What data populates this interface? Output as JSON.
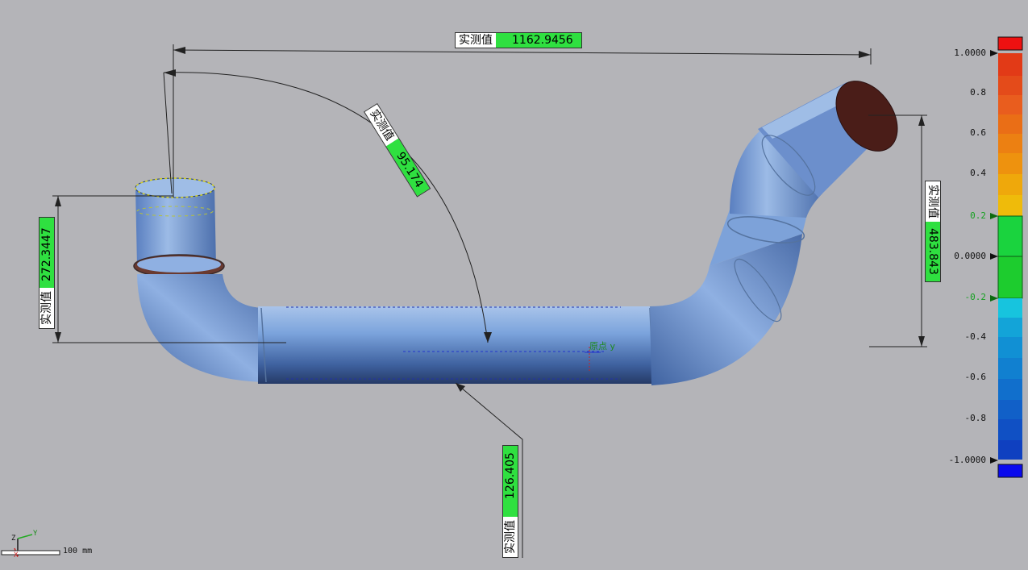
{
  "measurements": [
    {
      "id": "width",
      "key": "实测值",
      "value": "1162.9456"
    },
    {
      "id": "angle",
      "key": "实测值",
      "value": "95.174"
    },
    {
      "id": "left_height",
      "key": "实测值",
      "value": "272.3447"
    },
    {
      "id": "right_height",
      "key": "实测值",
      "value": "483.843"
    },
    {
      "id": "bottom",
      "key": "实测值",
      "value": "126.405"
    }
  ],
  "origin_label": "原点 y",
  "axis_triad": {
    "x": "X",
    "y": "Y",
    "z": "Z"
  },
  "scale_bar": {
    "label": "100 mm"
  },
  "color_scale": {
    "ticks": [
      "1.0000",
      "0.8",
      "0.6",
      "0.4",
      "0.2",
      "0.0000",
      "-0.2",
      "-0.4",
      "-0.6",
      "-0.8",
      "-1.0000"
    ],
    "tolerance_upper": 0.2,
    "tolerance_lower": -0.2,
    "colors": {
      "max": "#ee1111",
      "tolerance": "#11cc11",
      "min": "#0a0aee"
    }
  }
}
